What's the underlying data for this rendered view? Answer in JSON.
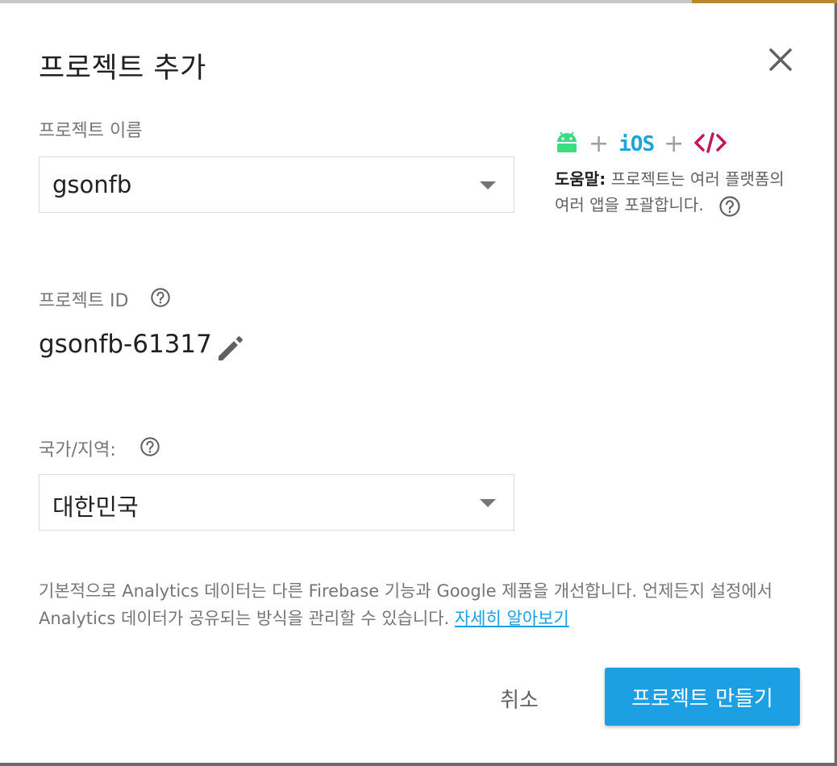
{
  "dialog": {
    "title": "프로젝트 추가"
  },
  "project_name": {
    "label": "프로젝트 이름",
    "value": "gsonfb"
  },
  "platforms": {
    "ios_label": "iOS",
    "web_label": "</>",
    "help_title": "도움말:",
    "help_body": "프로젝트는 여러 플랫폼의 여러 앱을 포괄합니다."
  },
  "project_id": {
    "label": "프로젝트 ID",
    "value": "gsonfb-61317"
  },
  "region": {
    "label": "국가/지역:",
    "value": "대한민국"
  },
  "analytics_notice": {
    "text": "기본적으로 Analytics 데이터는 다른 Firebase 기능과 Google 제품을 개선합니다. 언제든지 설정에서 Analytics 데이터가 공유되는 방식을 관리할 수 있습니다. ",
    "link_label": "자세히 알아보기"
  },
  "actions": {
    "cancel_label": "취소",
    "create_label": "프로젝트 만들기"
  },
  "colors": {
    "primary": "#1d9fe4",
    "link": "#1a9fe0",
    "android": "#3ddc84",
    "ios": "#1fa3db",
    "web": "#c2185b"
  },
  "icons": [
    "close-icon",
    "chevron-down-icon",
    "help-icon",
    "edit-pencil-icon",
    "android-icon",
    "plus-icon"
  ]
}
